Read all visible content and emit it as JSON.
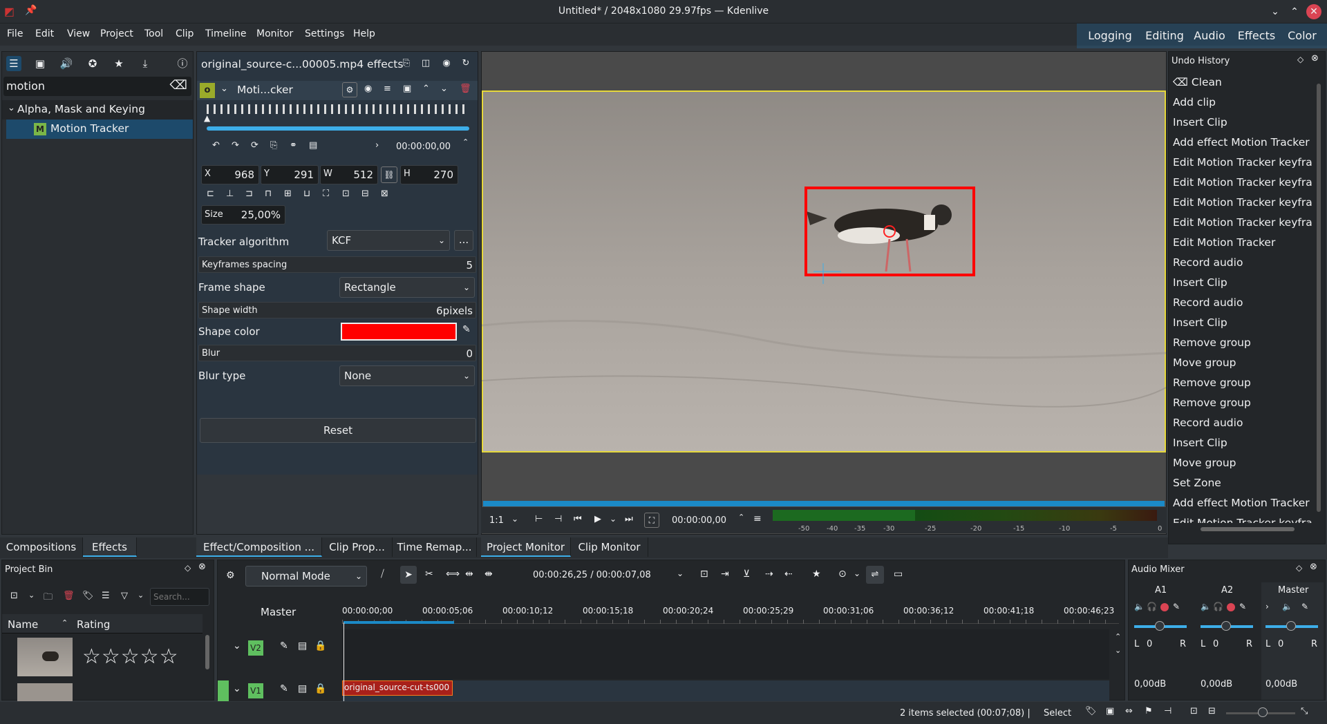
{
  "window": {
    "title": "Untitled* / 2048x1080 29.97fps — Kdenlive"
  },
  "menu": [
    "File",
    "Edit",
    "View",
    "Project",
    "Tool",
    "Clip",
    "Timeline",
    "Monitor",
    "Settings",
    "Help"
  ],
  "layouts": [
    "Logging",
    "Editing",
    "Audio",
    "Effects",
    "Color"
  ],
  "effects_panel": {
    "search_value": "motion",
    "category": "Alpha, Mask and Keying",
    "item": "Motion Tracker",
    "item_badge": "M"
  },
  "effect_stack": {
    "header": "original_source-c...00005.mp4 effects",
    "effect_name": "Moti...cker",
    "effect_badge": "o",
    "timecode": "00:00:00,00",
    "x_label": "X",
    "x": "968",
    "y_label": "Y",
    "y": "291",
    "w_label": "W",
    "w": "512",
    "h_label": "H",
    "h": "270",
    "size_label": "Size",
    "size": "25,00%",
    "tracker_algorithm_label": "Tracker algorithm",
    "tracker_algorithm": "KCF",
    "more_btn": "...",
    "keyframes_spacing_label": "Keyframes spacing",
    "keyframes_spacing": "5",
    "frame_shape_label": "Frame shape",
    "frame_shape": "Rectangle",
    "shape_width_label": "Shape width",
    "shape_width": "6pixels",
    "shape_color_label": "Shape color",
    "shape_color": "#ff0000",
    "blur_label": "Blur",
    "blur": "0",
    "blur_type_label": "Blur type",
    "blur_type": "None",
    "reset": "Reset"
  },
  "monitor": {
    "zoom": "1:1",
    "timecode": "00:00:00,00",
    "vu_ticks": [
      "-50",
      "-40",
      "-35",
      "-30",
      "-25",
      "-20",
      "-15",
      "-10",
      "-5",
      "0"
    ]
  },
  "undo_history": {
    "title": "Undo History",
    "items": [
      "Clean",
      "Add clip",
      "Insert Clip",
      "Add effect Motion Tracker",
      "Edit Motion Tracker keyfra",
      "Edit Motion Tracker keyfra",
      "Edit Motion Tracker keyfra",
      "Edit Motion Tracker keyfra",
      "Edit Motion Tracker",
      "Record audio",
      "Insert Clip",
      "Record audio",
      "Insert Clip",
      "Remove group",
      "Move group",
      "Remove group",
      "Remove group",
      "Record audio",
      "Insert Clip",
      "Move group",
      "Set Zone",
      "Add effect Motion Tracker",
      "Edit Motion Tracker keyfra"
    ]
  },
  "tabs_left": [
    "Compositions",
    "Effects"
  ],
  "tabs_mid": [
    "Effect/Composition ...",
    "Clip Prop...",
    "Time Remap..."
  ],
  "tabs_monitor": [
    "Project Monitor",
    "Clip Monitor"
  ],
  "project_bin": {
    "title": "Project Bin",
    "search_placeholder": "Search...",
    "col_name": "Name",
    "col_rating": "Rating",
    "stars": "☆☆☆☆☆"
  },
  "timeline": {
    "mode": "Normal Mode",
    "timecode": "00:00:26,25 / 00:00:07,08",
    "master": "Master",
    "ruler": [
      "00:00:00;00",
      "00:00:05;06",
      "00:00:10;12",
      "00:00:15;18",
      "00:00:20;24",
      "00:00:25;29",
      "00:00:31;06",
      "00:00:36;12",
      "00:00:41;18",
      "00:00:46;23"
    ],
    "tracks": [
      {
        "name": "V2"
      },
      {
        "name": "V1"
      }
    ],
    "clip_name": "original_source-cut-ts000"
  },
  "audio_mixer": {
    "title": "Audio Mixer",
    "channels": [
      {
        "name": "A1",
        "db": "0,00dB",
        "L": "L",
        "lv": "0",
        "R": "R"
      },
      {
        "name": "A2",
        "db": "0,00dB",
        "L": "L",
        "lv": "0",
        "R": "R"
      },
      {
        "name": "Master",
        "db": "0,00dB",
        "L": "L",
        "lv": "0",
        "R": "R"
      }
    ]
  },
  "status": {
    "selection": "2 items selected (00:07;08) |",
    "tool": "Select"
  },
  "colors": {
    "accent": "#3daee9",
    "clip": "#a8201a",
    "track_green": "#5fbf5f",
    "tracker_rect": "#ff0000"
  }
}
